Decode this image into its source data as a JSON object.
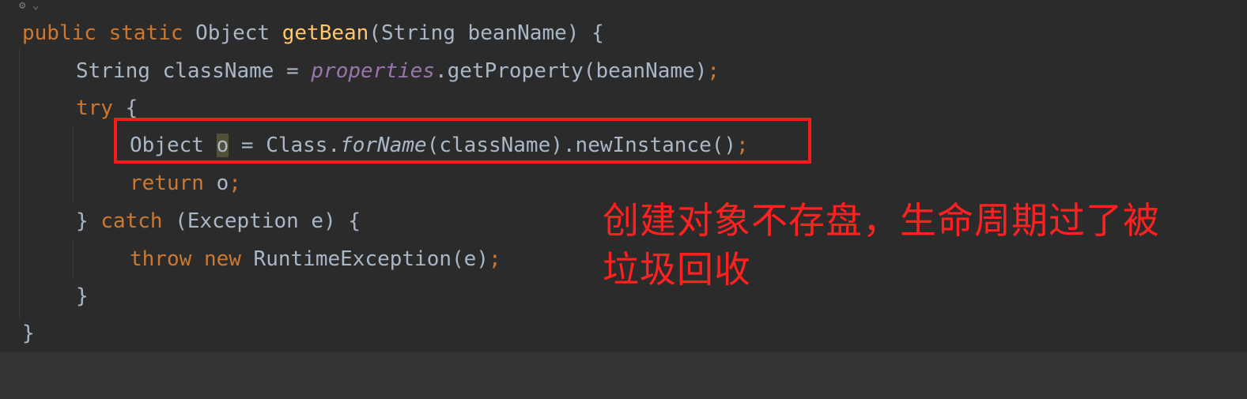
{
  "gutter": {
    "icon": "code-vision-icon",
    "glyph": "⚙ ⌄"
  },
  "code": {
    "line1": {
      "kw1": "public",
      "kw2": "static",
      "type": "Object",
      "fn": "getBean",
      "rest": "(String beanName) {"
    },
    "line2": {
      "prefix": "String className = ",
      "field": "properties",
      "rest": ".getProperty(beanName)",
      "semi": ";"
    },
    "line3": {
      "kw": "try",
      "rest": " {"
    },
    "line4": {
      "pre": "Object ",
      "var": "o",
      "mid": " = Class.",
      "method": "forName",
      "post": "(className).newInstance()",
      "semi": ";"
    },
    "line5": {
      "kw": "return",
      "rest": " o",
      "semi": ";"
    },
    "line6": {
      "pre": "} ",
      "kw": "catch",
      "rest": " (Exception e) {"
    },
    "line7": {
      "kw1": "throw",
      "kw2": "new",
      "rest": " RuntimeException(e)",
      "semi": ";"
    },
    "line8": {
      "text": "}"
    },
    "line9": {
      "text": "}"
    }
  },
  "annotation": {
    "line1": "创建对象不存盘，生命周期过了被",
    "line2": "垃圾回收",
    "color": "#ff2020"
  },
  "colors": {
    "background": "#2b2b2b",
    "keyword": "#cc7832",
    "function": "#ffc66d",
    "field": "#9876aa",
    "text": "#a9b7c6",
    "highlight_border": "#ff1a1a"
  }
}
